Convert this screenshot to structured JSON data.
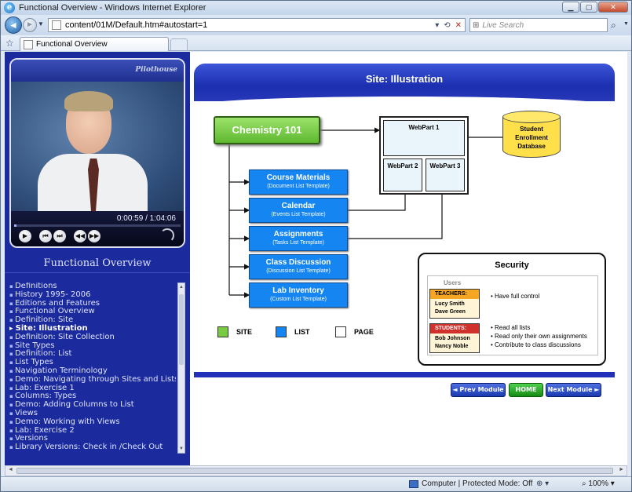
{
  "window": {
    "title": "Functional Overview - Windows Internet Explorer"
  },
  "address": {
    "url": "content/01M/Default.htm#autostart=1"
  },
  "search": {
    "placeholder": "Live Search"
  },
  "tabs": [
    {
      "label": "Functional Overview"
    }
  ],
  "video": {
    "logo": "Pilothouse",
    "time": "0:00:59 / 1:04:06",
    "progress": 0.015
  },
  "left": {
    "heading": "Functional Overview",
    "topics": [
      "Definitions",
      "History 1995- 2006",
      "Editions and Features",
      "Functional Overview",
      "Definition: Site",
      "Site: Illustration",
      "Definition: Site Collection",
      "Site Types",
      "Definition: List",
      "List Types",
      "Navigation Terminology",
      "Demo: Navigating through Sites and Lists",
      "Lab: Exercise 1",
      "Columns: Types",
      "Demo: Adding Columns to List",
      "Views",
      "Demo: Working with Views",
      "Lab: Exercise 2",
      "Versions",
      "Library Versions: Check in /Check Out"
    ],
    "active_index": 5
  },
  "slide": {
    "title": "Site:  Illustration",
    "site_box": "Chemistry 101",
    "lists": [
      {
        "title": "Course Materials",
        "sub": "(Document  List Template)"
      },
      {
        "title": "Calendar",
        "sub": "(Events  List Template)"
      },
      {
        "title": "Assignments",
        "sub": "(Tasks  List Template)"
      },
      {
        "title": "Class Discussion",
        "sub": "(Discussion List Template)"
      },
      {
        "title": "Lab Inventory",
        "sub": "(Custom  List Template)"
      }
    ],
    "webparts": [
      "WebPart 1",
      "WebPart 2",
      "WebPart 3"
    ],
    "database": [
      "Student",
      "Enrollment",
      "Database"
    ],
    "legend": [
      {
        "label": "SITE",
        "color": "#77cc44"
      },
      {
        "label": "LIST",
        "color": "#1585f2"
      },
      {
        "label": "PAGE",
        "color": "#ffffff"
      }
    ],
    "security": {
      "title": "Security",
      "users_label": "Users",
      "teachers": {
        "role": "TEACHERS:",
        "names": [
          "Lucy Smith",
          "Dave Green"
        ],
        "color": "#f5a623"
      },
      "students": {
        "role": "STUDENTS:",
        "names": [
          "Bob Johnson",
          "Nancy Noble"
        ],
        "color": "#d0312d"
      },
      "teacher_perms": [
        "Have full control"
      ],
      "student_perms": [
        "Read all lists",
        "Read only their own assignments",
        "Contribute to class discussions"
      ]
    }
  },
  "nav": {
    "prev": "◄ Prev Module",
    "home": "HOME",
    "next": "Next Module ►"
  },
  "status": {
    "zone": "Computer | Protected Mode: Off",
    "zoom": "100%"
  }
}
